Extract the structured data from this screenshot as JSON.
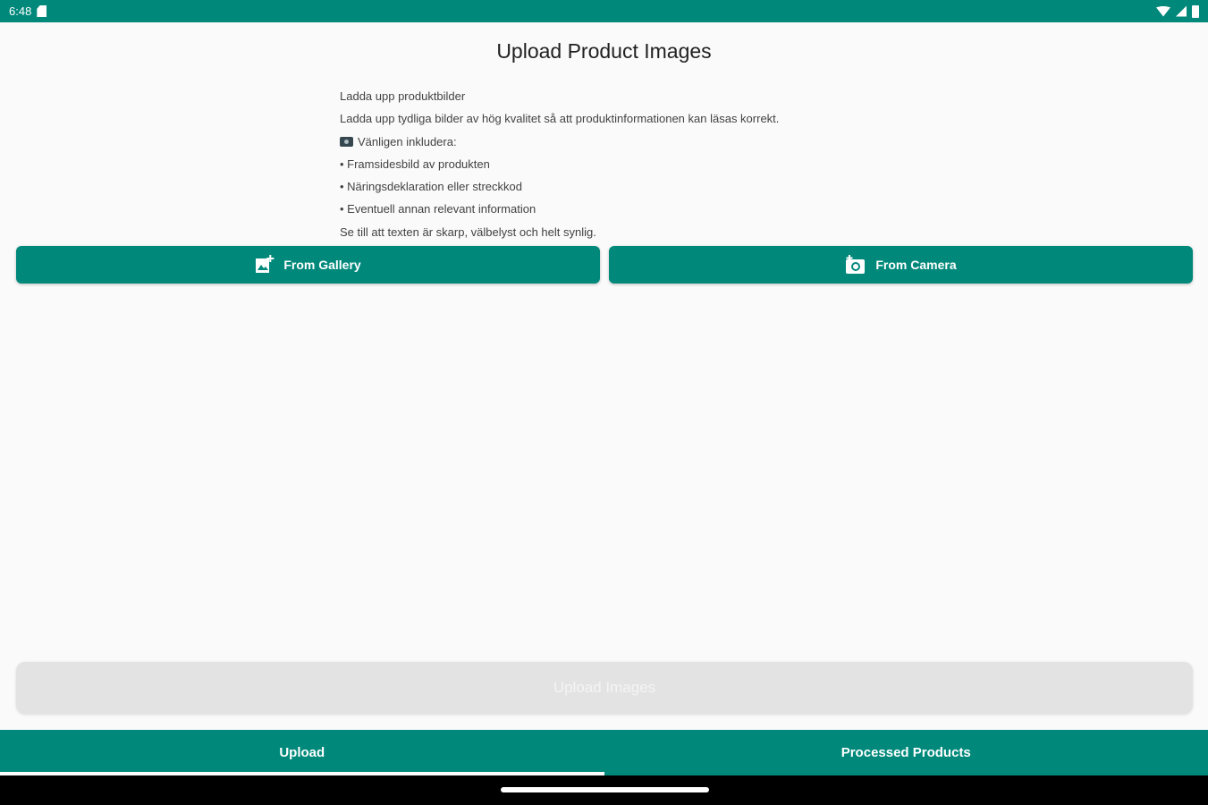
{
  "status_bar": {
    "time": "6:48",
    "icons": [
      "sd-card-icon",
      "wifi-icon",
      "signal-icon",
      "battery-icon"
    ]
  },
  "page": {
    "title": "Upload Product Images"
  },
  "instructions": {
    "heading": "Ladda upp produktbilder",
    "intro": "Ladda upp tydliga bilder av hög kvalitet så att produktinformationen kan läsas korrekt.",
    "include_label": "Vänligen inkludera:",
    "bullets": [
      "• Framsidesbild av produkten",
      "• Näringsdeklaration eller streckkod",
      "• Eventuell annan relevant information"
    ],
    "footer": "Se till att texten är skarp, välbelyst och helt synlig."
  },
  "actions": {
    "gallery_label": "From Gallery",
    "camera_label": "From Camera"
  },
  "upload": {
    "label": "Upload Images",
    "disabled": true
  },
  "bottom_nav": {
    "tabs": [
      {
        "label": "Upload",
        "active": true
      },
      {
        "label": "Processed Products",
        "active": false
      }
    ]
  },
  "colors": {
    "primary": "#00897b",
    "background": "#fafafa",
    "disabled_button": "#e3e3e3"
  }
}
